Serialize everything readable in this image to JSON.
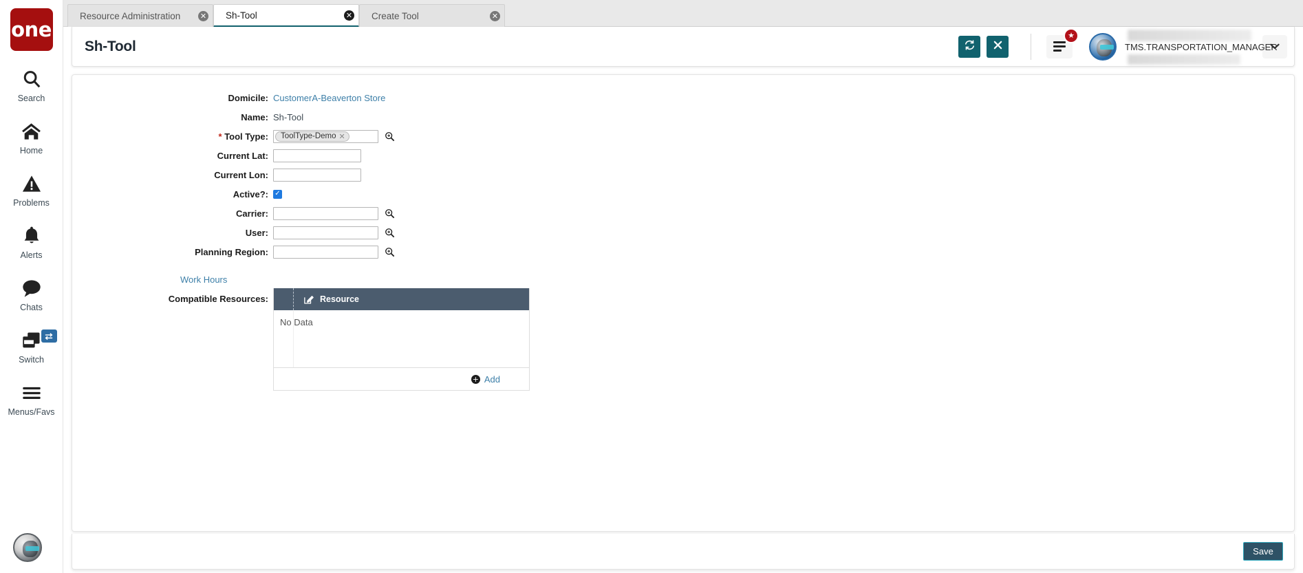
{
  "brand": {
    "logo_text": "one"
  },
  "sidebar": {
    "items": [
      {
        "label": "Search",
        "icon": "search-icon"
      },
      {
        "label": "Home",
        "icon": "home-icon"
      },
      {
        "label": "Problems",
        "icon": "warning-triangle-icon"
      },
      {
        "label": "Alerts",
        "icon": "bell-icon"
      },
      {
        "label": "Chats",
        "icon": "chat-bubble-icon"
      },
      {
        "label": "Switch",
        "icon": "windows-stack-icon",
        "badge_icon": "swap-arrows-icon"
      },
      {
        "label": "Menus/Favs",
        "icon": "hamburger-icon"
      }
    ],
    "assistant_icon": "ai-assistant-avatar"
  },
  "tabs": [
    {
      "label": "Resource Administration",
      "active": false,
      "close_icon": "close-circle-icon"
    },
    {
      "label": "Sh-Tool",
      "active": true,
      "close_icon": "close-circle-icon"
    },
    {
      "label": "Create Tool",
      "active": false,
      "close_icon": "close-circle-icon"
    }
  ],
  "header": {
    "title": "Sh-Tool",
    "refresh_icon": "refresh-icon",
    "close_icon": "x-icon",
    "menu_icon": "hamburger-icon",
    "favorites_badge_icon": "star-icon",
    "avatar_icon": "user-avatar",
    "user_name": "TMS.TRANSPORTATION_MANAGER",
    "caret_icon": "chevron-down-icon"
  },
  "form": {
    "fields": [
      {
        "name": "domicile",
        "label": "Domicile:",
        "type": "link",
        "value": "CustomerA-Beaverton Store",
        "required": false
      },
      {
        "name": "name",
        "label": "Name:",
        "type": "text",
        "value": "Sh-Tool",
        "required": false
      },
      {
        "name": "tool-type",
        "label": "Tool Type:",
        "type": "chip",
        "value": "ToolType-Demo",
        "required": true,
        "lookup_icon": "magnifier-icon",
        "chip_remove_icon": "x-icon"
      },
      {
        "name": "current-lat",
        "label": "Current Lat:",
        "type": "input",
        "value": "",
        "placeholder": "",
        "required": false
      },
      {
        "name": "current-lon",
        "label": "Current Lon:",
        "type": "input",
        "value": "",
        "placeholder": "",
        "required": false
      },
      {
        "name": "active",
        "label": "Active?:",
        "type": "checkbox",
        "checked": true,
        "required": false
      },
      {
        "name": "carrier",
        "label": "Carrier:",
        "type": "lookup",
        "value": "",
        "placeholder": "",
        "required": false,
        "lookup_icon": "magnifier-icon"
      },
      {
        "name": "user",
        "label": "User:",
        "type": "lookup",
        "value": "",
        "placeholder": "",
        "required": false,
        "lookup_icon": "magnifier-icon"
      },
      {
        "name": "planning-region",
        "label": "Planning Region:",
        "type": "lookup",
        "value": "",
        "placeholder": "",
        "required": false,
        "lookup_icon": "magnifier-icon"
      }
    ],
    "work_hours_link": "Work Hours",
    "compatible_resources_label": "Compatible Resources:"
  },
  "grid": {
    "edit_icon": "edit-pencil-icon",
    "columns": [
      "Resource"
    ],
    "rows": [],
    "empty_text": "No Data",
    "add_label": "Add",
    "add_icon": "plus-circle-icon"
  },
  "footer": {
    "save_label": "Save"
  },
  "colors": {
    "brand_red": "#a50f0f",
    "accent_teal": "#11626e",
    "grid_header": "#4b5c6e",
    "link_blue": "#3d7fa8",
    "save_bg": "#2e5266",
    "save_border": "#2fa8bd",
    "badge_red": "#b3121a",
    "checkbox_blue": "#1f7ae0",
    "active_tab_underline": "#11626e"
  }
}
